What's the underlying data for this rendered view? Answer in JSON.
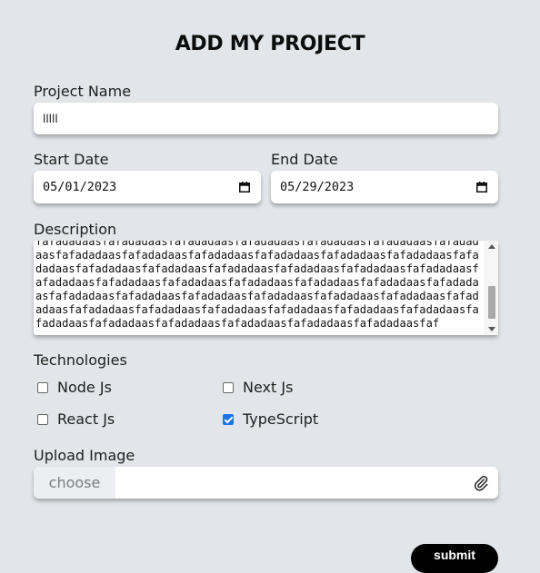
{
  "form": {
    "title": "ADD MY PROJECT",
    "project_name": {
      "label": "Project Name",
      "value": "lllll"
    },
    "start_date": {
      "label": "Start Date",
      "value": "05/01/2023"
    },
    "end_date": {
      "label": "End Date",
      "value": "05/29/2023"
    },
    "description": {
      "label": "Description",
      "value": "fafadadaasfafadadaasfafadadaasfafadadaasfafadadaasfafadadaasfafadadaasfafadadaasfafadadaasfafadadaasfafadadaasfafadadaasfafadadaasfafadadaasfafadadaasfafadadaasfafadadaasfafadadaasfafadadaasfafadadaasfafadadaasfafadadaasfafadadaasfafadadaasfafadadaasfafadadaasfafadadaasfafadadaasfafadadaasfafadadaasfafadadaasfafadadaasfafadadaasfafadadaasfafadadaasfafadadaasfafadadaasfafadadaasfafadadaasfafadadaasfafadadaasfafadadaasfafadadaasfafadadaasfafadadaasfafadadaasfaf"
    },
    "technologies": {
      "label": "Technologies",
      "items": [
        {
          "label": "Node Js",
          "checked": false
        },
        {
          "label": "Next Js",
          "checked": false
        },
        {
          "label": "React Js",
          "checked": false
        },
        {
          "label": "TypeScript",
          "checked": true
        }
      ]
    },
    "upload": {
      "label": "Upload Image",
      "choose_label": "choose"
    },
    "submit_label": "submit"
  },
  "colors": {
    "background": "#e2e5ea",
    "checkbox_accent": "#1a73e8",
    "submit_bg": "#000000"
  },
  "icons": {
    "date": "calendar-icon",
    "attach": "paperclip-icon"
  }
}
